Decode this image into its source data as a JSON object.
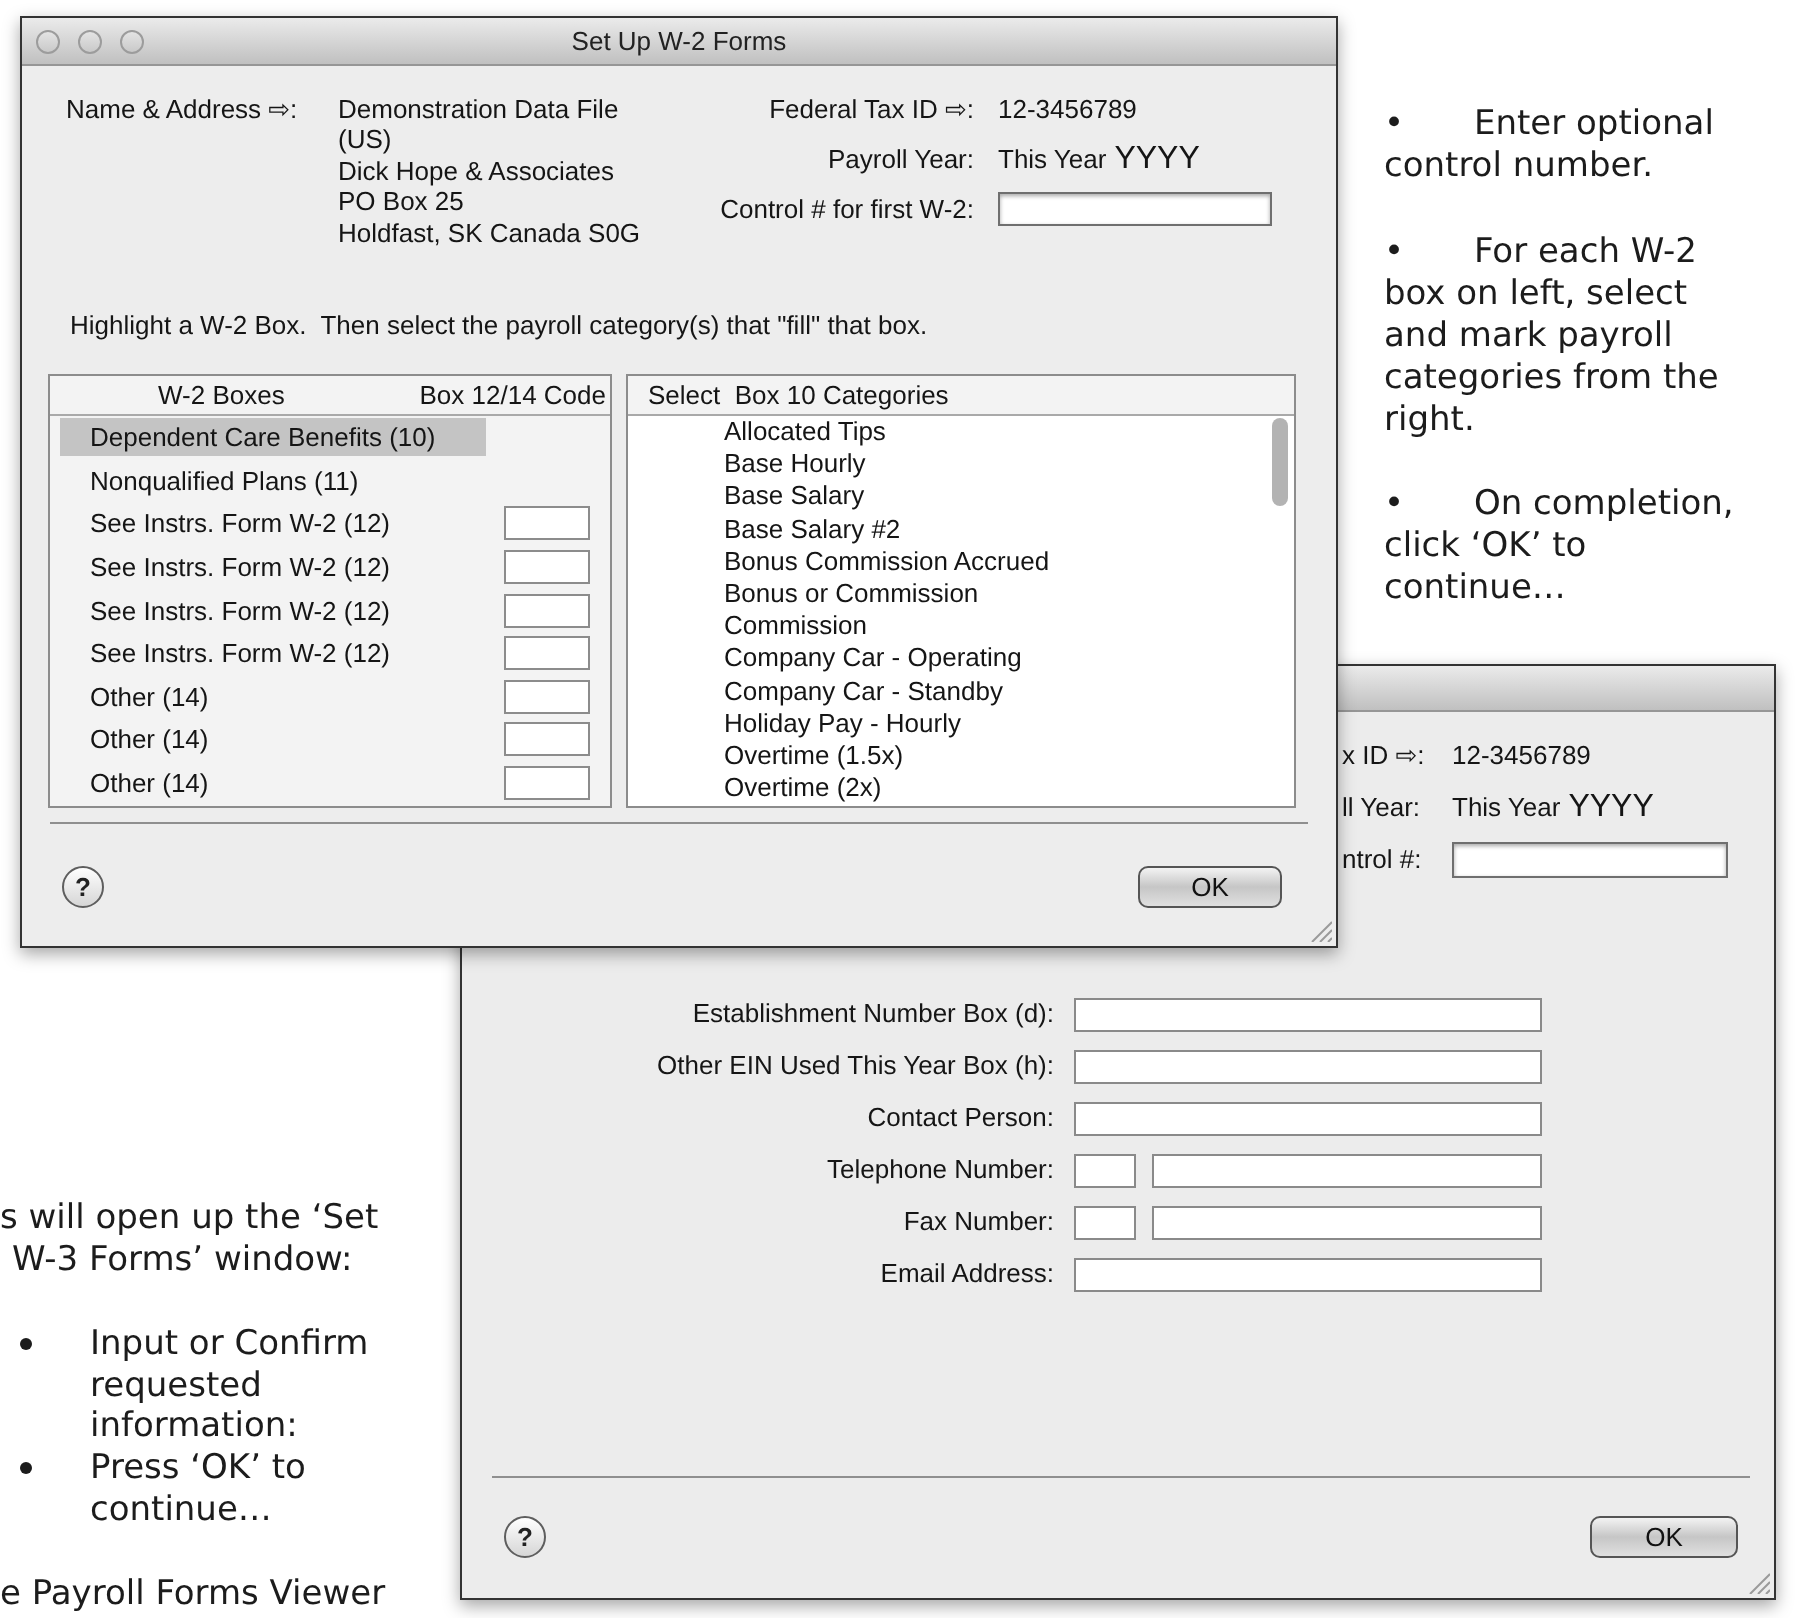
{
  "document": {
    "notes": [
      {
        "text": "•\tEnter optional control number."
      },
      {
        "text": "•\tFor each W-2 box on left, select and mark payroll categories from the right."
      },
      {
        "text": "•\tOn completion, click ‘OK’ to continue…"
      }
    ],
    "intro_lines": [
      "s will open up the ‘Set",
      "W-3 Forms’ window:"
    ],
    "steps": [
      "Input or Confirm requested information:",
      "Press ‘OK’ to continue…"
    ],
    "closing_line": "e Payroll Forms Viewer"
  },
  "w2_window": {
    "title": "Set Up W-2 Forms",
    "name_address_label": "Name & Address ⇨:",
    "address_lines": [
      "Demonstration Data File",
      "(US)",
      "Dick Hope & Associates",
      "PO Box 25",
      "Holdfast, SK Canada S0G"
    ],
    "header_fields": [
      {
        "label": "Federal Tax ID ⇨:",
        "kind": "text",
        "value": "12-3456789"
      },
      {
        "label": "Payroll Year:",
        "kind": "year",
        "value": "This Year",
        "year": "YYYY"
      },
      {
        "label": "Control # for first W-2:",
        "kind": "input"
      }
    ],
    "instruction": "Highlight a W-2 Box.  Then select the payroll category(s) that \"fill\" that box.",
    "boxes_columns": [
      "W-2 Boxes",
      "Box 12/14 Code"
    ],
    "boxes": [
      {
        "label": "Dependent Care Benefits (10)",
        "kind": "plain",
        "selected": true
      },
      {
        "label": "Nonqualified Plans (11)",
        "kind": "plain",
        "selected": false
      },
      {
        "label": "See Instrs. Form W-2 (12)",
        "kind": "code",
        "selected": false
      },
      {
        "label": "See Instrs. Form W-2 (12)",
        "kind": "code",
        "selected": false
      },
      {
        "label": "See Instrs. Form W-2 (12)",
        "kind": "code",
        "selected": false
      },
      {
        "label": "See Instrs. Form W-2 (12)",
        "kind": "code",
        "selected": false
      },
      {
        "label": "Other (14)",
        "kind": "code",
        "selected": false
      },
      {
        "label": "Other (14)",
        "kind": "code",
        "selected": false
      },
      {
        "label": "Other (14)",
        "kind": "code",
        "selected": false
      }
    ],
    "categories_header": "Select  Box 10 Categories",
    "categories": [
      {
        "label": "Allocated Tips",
        "selected": false
      },
      {
        "label": "Base Hourly",
        "selected": false
      },
      {
        "label": "Base Salary",
        "selected": false
      },
      {
        "label": "Base Salary #2",
        "selected": false
      },
      {
        "label": "Bonus Commission Accrued",
        "selected": false
      },
      {
        "label": "Bonus or Commission",
        "selected": false
      },
      {
        "label": "Commission",
        "selected": false
      },
      {
        "label": "Company Car - Operating",
        "selected": false
      },
      {
        "label": "Company Car - Standby",
        "selected": false
      },
      {
        "label": "Holiday Pay - Hourly",
        "selected": false
      },
      {
        "label": "Overtime (1.5x)",
        "selected": false
      },
      {
        "label": "Overtime (2x)",
        "selected": false
      }
    ],
    "help_button": "?",
    "ok_button": "OK"
  },
  "w3_window": {
    "header_fields": [
      {
        "label": "x ID ⇨:",
        "kind": "text",
        "value": "12-3456789"
      },
      {
        "label": "ll Year:",
        "kind": "year",
        "value": "This Year",
        "year": "YYYY"
      },
      {
        "label": "ntrol #:",
        "kind": "input"
      }
    ],
    "fields": [
      {
        "label": "Establishment Number Box (d):",
        "kind": "single"
      },
      {
        "label": "Other EIN Used This Year Box (h):",
        "kind": "single"
      },
      {
        "label": "Contact Person:",
        "kind": "single"
      },
      {
        "label": "Telephone Number:",
        "kind": "phone"
      },
      {
        "label": "Fax Number:",
        "kind": "phone"
      },
      {
        "label": "Email Address:",
        "kind": "single"
      }
    ],
    "help_button": "?",
    "ok_button": "OK"
  }
}
